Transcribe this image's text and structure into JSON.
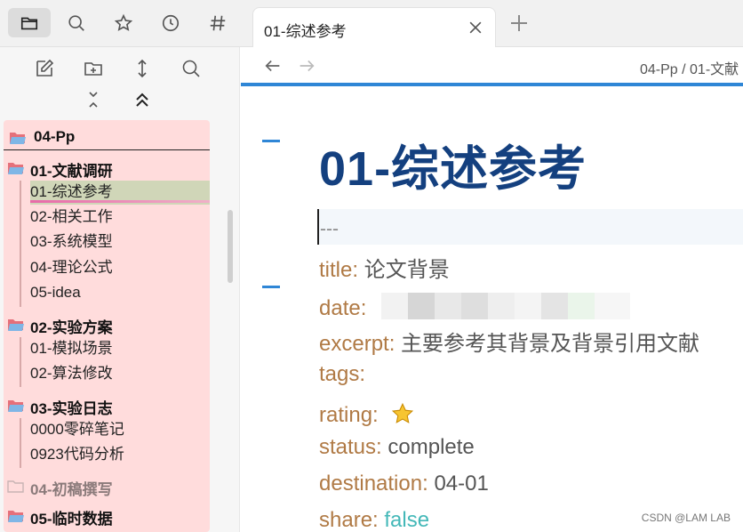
{
  "tab": {
    "title": "01-综述参考"
  },
  "breadcrumb": "04-Pp / 01-文献",
  "sidebar": {
    "root": "04-Pp",
    "folders": [
      {
        "label": "01-文献调研",
        "files": [
          "01-综述参考",
          "02-相关工作",
          "03-系统模型",
          "04-理论公式",
          "05-idea"
        ]
      },
      {
        "label": "02-实验方案",
        "files": [
          "01-模拟场景",
          "02-算法修改"
        ]
      },
      {
        "label": "03-实验日志",
        "files": [
          "0000零碎笔记",
          "0923代码分析"
        ]
      },
      {
        "label": "04-初稿撰写",
        "files": []
      },
      {
        "label": "05-临时数据",
        "files": []
      }
    ]
  },
  "doc": {
    "title": "01-综述参考",
    "yaml_delim": "---",
    "props": [
      {
        "key": "title",
        "value": "论文背景"
      },
      {
        "key": "date",
        "value": ""
      },
      {
        "key": "excerpt",
        "value": "主要参考其背景及背景引用文献"
      },
      {
        "key": "tags",
        "value": ""
      },
      {
        "key": "rating",
        "value": ""
      },
      {
        "key": "status",
        "value": "complete"
      },
      {
        "key": "destination",
        "value": "04-01"
      },
      {
        "key": "share",
        "value": "false"
      }
    ]
  },
  "watermark": "CSDN @LAM LAB",
  "colors": {
    "accent": "#2f86d6",
    "title": "#14407f",
    "key": "#b07a45",
    "tree_bg": "#ffdcdc",
    "active_file": "#d0d6b8"
  }
}
